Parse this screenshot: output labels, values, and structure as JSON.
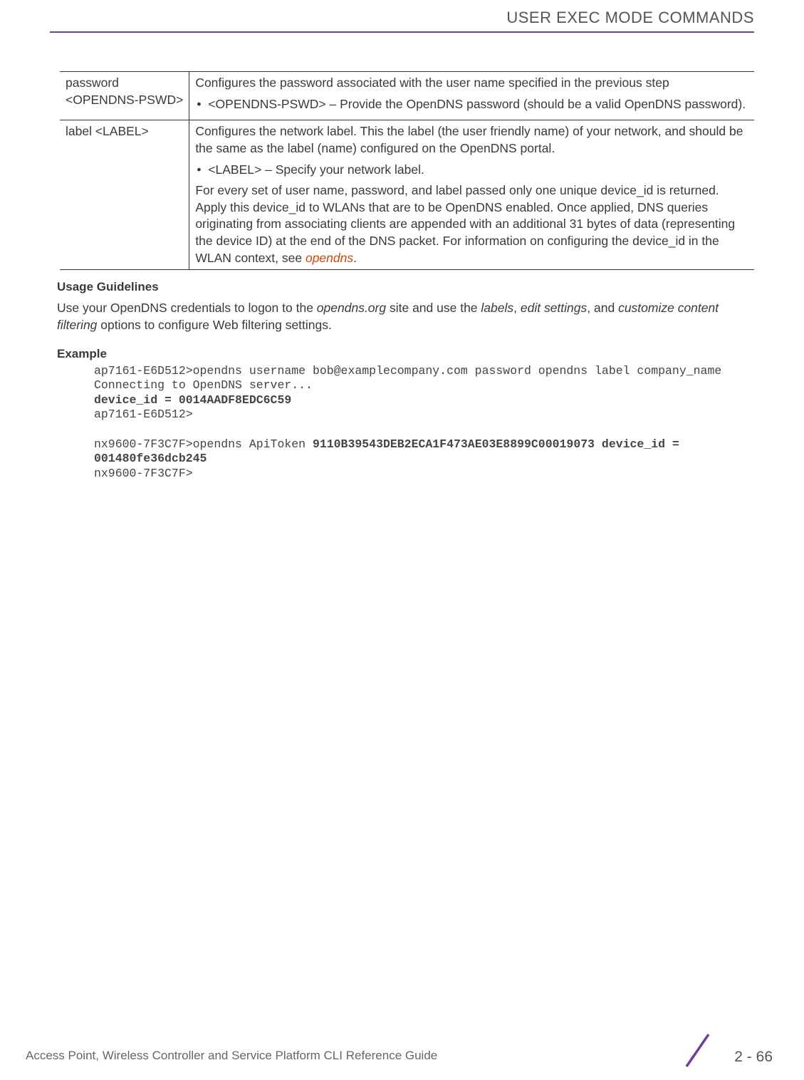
{
  "header": "USER EXEC MODE COMMANDS",
  "table": {
    "row1": {
      "param": "password <OPENDNS-PSWD>",
      "desc": "Configures the password associated with the user name specified in the previous step",
      "bullet": "<OPENDNS-PSWD> – Provide the OpenDNS password (should be a valid OpenDNS password)."
    },
    "row2": {
      "param": "label <LABEL>",
      "desc1": "Configures the network label. This the label (the user friendly name) of your network, and should be the same as the label (name) configured on the OpenDNS portal.",
      "bullet": "<LABEL> – Specify your network label.",
      "desc2_pre": "For every set of user name, password, and label passed only one unique device_id is returned. Apply this device_id to WLANs that are to be OpenDNS enabled. Once applied, DNS queries originating from associating clients are appended with an additional 31 bytes of data (representing the device ID) at the end of the DNS packet. For information on configuring the device_id in the WLAN context, see ",
      "desc2_link": "opendns",
      "desc2_post": "."
    }
  },
  "usage": {
    "heading": "Usage Guidelines",
    "pre1": "Use your OpenDNS credentials to logon to the ",
    "i1": "opendns.org",
    "mid1": " site and use the ",
    "i2": "labels",
    "mid2": ", ",
    "i3": "edit settings",
    "mid3": ", and ",
    "i4": "customize content filtering",
    "post": " options to configure Web filtering settings."
  },
  "example": {
    "heading": "Example",
    "l1": "ap7161-E6D512>opendns username bob@examplecompany.com password opendns label company_name",
    "l2": "Connecting to OpenDNS server...",
    "l3": "device_id = 0014AADF8EDC6C59",
    "l4": "ap7161-E6D512>",
    "l5a": "nx9600-7F3C7F>opendns ApiToken ",
    "l5b": "9110B39543DEB2ECA1F473AE03E8899C00019073 device_id = 001480fe36dcb245",
    "l6": "nx9600-7F3C7F>"
  },
  "footer": {
    "text": "Access Point, Wireless Controller and Service Platform CLI Reference Guide",
    "page": "2 - 66"
  }
}
